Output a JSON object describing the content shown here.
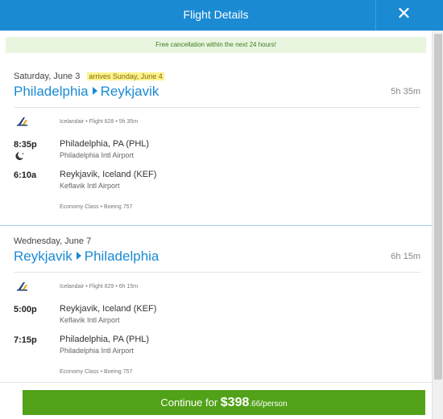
{
  "header": {
    "title": "Flight Details",
    "close_glyph": "✕"
  },
  "banner": {
    "text": "Free cancellation within the next 24 hours!"
  },
  "legs": [
    {
      "date": "Saturday, June 3",
      "arrives": "arrives Sunday, June 4",
      "from": "Philadelphia",
      "to": "Reykjavik",
      "duration": "5h 35m",
      "airline_line": "Icelandair • Flight 828 • 5h 35m",
      "depart_time": "8:35p",
      "depart_city": "Philadelphia, PA (PHL)",
      "depart_airport": "Philadelphia Intl Airport",
      "arrive_time": "6:10a",
      "arrive_city": "Reykjavik, Iceland (KEF)",
      "arrive_airport": "Keflavik Intl Airport",
      "cabin": "Economy Class • Boeing 757",
      "overnight_icon": "moon-icon"
    },
    {
      "date": "Wednesday, June 7",
      "from": "Reykjavik",
      "to": "Philadelphia",
      "duration": "6h 15m",
      "airline_line": "Icelandair • Flight 829 • 6h 15m",
      "depart_time": "5:00p",
      "depart_city": "Reykjavik, Iceland (KEF)",
      "depart_airport": "Keflavik Intl Airport",
      "arrive_time": "7:15p",
      "arrive_city": "Philadelphia, PA (PHL)",
      "arrive_airport": "Philadelphia Intl Airport",
      "cabin": "Economy Class • Boeing 757"
    }
  ],
  "cta": {
    "prefix": "Continue for ",
    "amount": "$398",
    "cents": ".66",
    "suffix": "/person"
  },
  "icons": {
    "airline": "airline-logo-icon",
    "close": "close-icon"
  },
  "colors": {
    "header": "#1a8ad3",
    "cta": "#52a219",
    "highlight": "#fbf48e",
    "banner_bg": "#e8f6e0"
  }
}
